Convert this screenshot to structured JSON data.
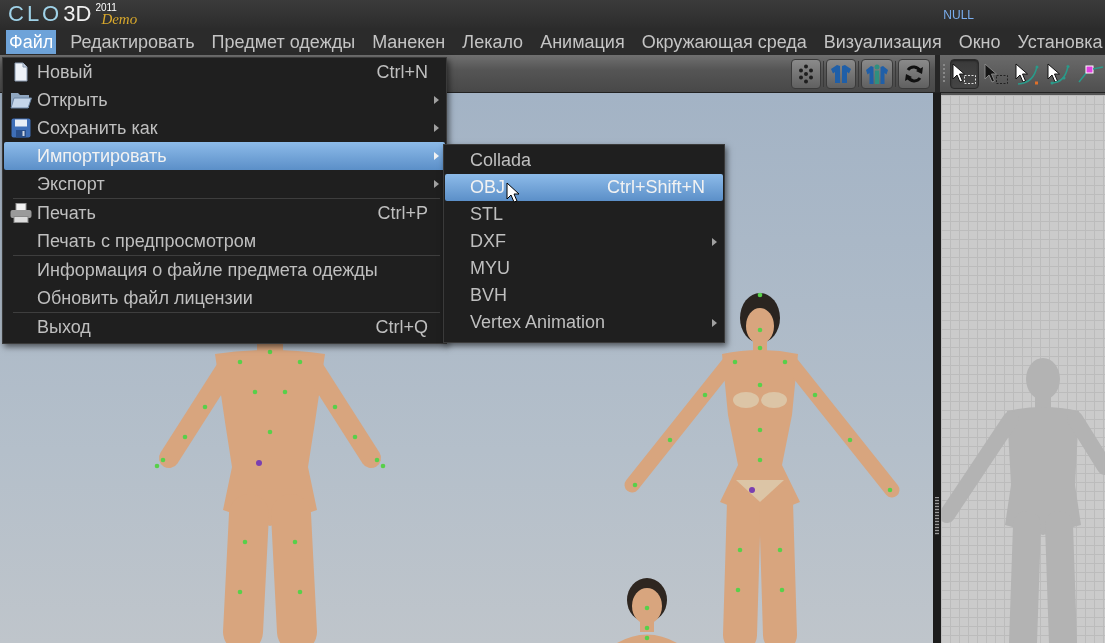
{
  "title_bar": {
    "logo": {
      "brand": "CLO",
      "product": "3D",
      "year": "2011",
      "edition": "Demo"
    },
    "status": "NULL"
  },
  "menu_bar": [
    {
      "label": "Файл",
      "selected": true
    },
    {
      "label": "Редактировать",
      "selected": false
    },
    {
      "label": "Предмет одежды",
      "selected": false
    },
    {
      "label": "Манекен",
      "selected": false
    },
    {
      "label": "Лекало",
      "selected": false
    },
    {
      "label": "Анимация",
      "selected": false
    },
    {
      "label": "Окружающая среда",
      "selected": false
    },
    {
      "label": "Визуализация",
      "selected": false
    },
    {
      "label": "Окно",
      "selected": false
    },
    {
      "label": "Установка",
      "selected": false
    }
  ],
  "tools": [
    {
      "selected": true
    },
    {
      "selected": false
    },
    {
      "selected": false
    },
    {
      "selected": false
    },
    {
      "selected": false
    }
  ],
  "file_menu": {
    "groups": [
      [
        {
          "label": "Новый",
          "shortcut": "Ctrl+N",
          "submenu": false,
          "selected": false
        },
        {
          "label": "Открыть",
          "submenu": true,
          "selected": false
        },
        {
          "label": "Сохранить как",
          "submenu": true,
          "selected": false
        },
        {
          "label": "Импортировать",
          "submenu": true,
          "selected": true
        },
        {
          "label": "Экспорт",
          "submenu": true,
          "selected": false
        }
      ],
      [
        {
          "label": "Печать",
          "shortcut": "Ctrl+P",
          "submenu": false,
          "selected": false
        },
        {
          "label": "Печать с предпросмотром",
          "submenu": false,
          "selected": false
        }
      ],
      [
        {
          "label": "Информация о файле предмета одежды",
          "submenu": false,
          "selected": false
        },
        {
          "label": "Обновить файл лицензии",
          "submenu": false,
          "selected": false
        }
      ],
      [
        {
          "label": "Выход",
          "shortcut": "Ctrl+Q",
          "submenu": false,
          "selected": false
        }
      ]
    ]
  },
  "import_menu": {
    "items": [
      {
        "label": "Collada",
        "submenu": false,
        "selected": false
      },
      {
        "label": "OBJ",
        "shortcut": "Ctrl+Shift+N",
        "submenu": false,
        "selected": true
      },
      {
        "label": "STL",
        "submenu": false,
        "selected": false
      },
      {
        "label": "DXF",
        "submenu": true,
        "selected": false
      },
      {
        "label": "MYU",
        "submenu": false,
        "selected": false
      },
      {
        "label": "BVH",
        "submenu": false,
        "selected": false
      },
      {
        "label": "Vertex Animation",
        "submenu": true,
        "selected": false
      }
    ]
  }
}
